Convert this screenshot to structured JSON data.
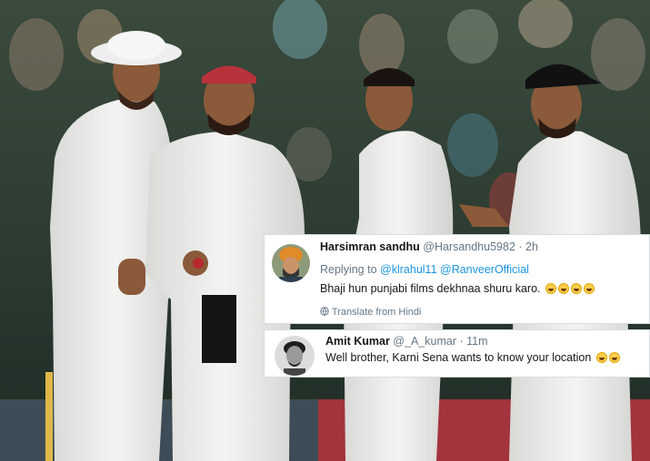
{
  "scene": {
    "description_icon": "cricket-players-photo"
  },
  "tweets": [
    {
      "name": "Harsimran sandhu",
      "handle": "@Harsandhu5982",
      "separator": "·",
      "time": "2h",
      "replying_prefix": "Replying to",
      "mention1": "@klrahul11",
      "mention2": "@RanveerOfficial",
      "text": "Bhaji hun punjabi films dekhnaa shuru karo.",
      "emoji_count": 4,
      "emoji_icon": "laughing-tears-emoji",
      "translate_label": "Translate from Hindi"
    },
    {
      "name": "Amit Kumar",
      "handle": "@_A_kumar",
      "separator": "·",
      "time": "11m",
      "text": "Well brother, Karni Sena wants to know your location",
      "emoji_count": 2,
      "emoji_icon": "laughing-tears-emoji"
    }
  ],
  "colors": {
    "link": "#1b95e0",
    "secondary_text": "#657786",
    "primary_text": "#14171a"
  }
}
